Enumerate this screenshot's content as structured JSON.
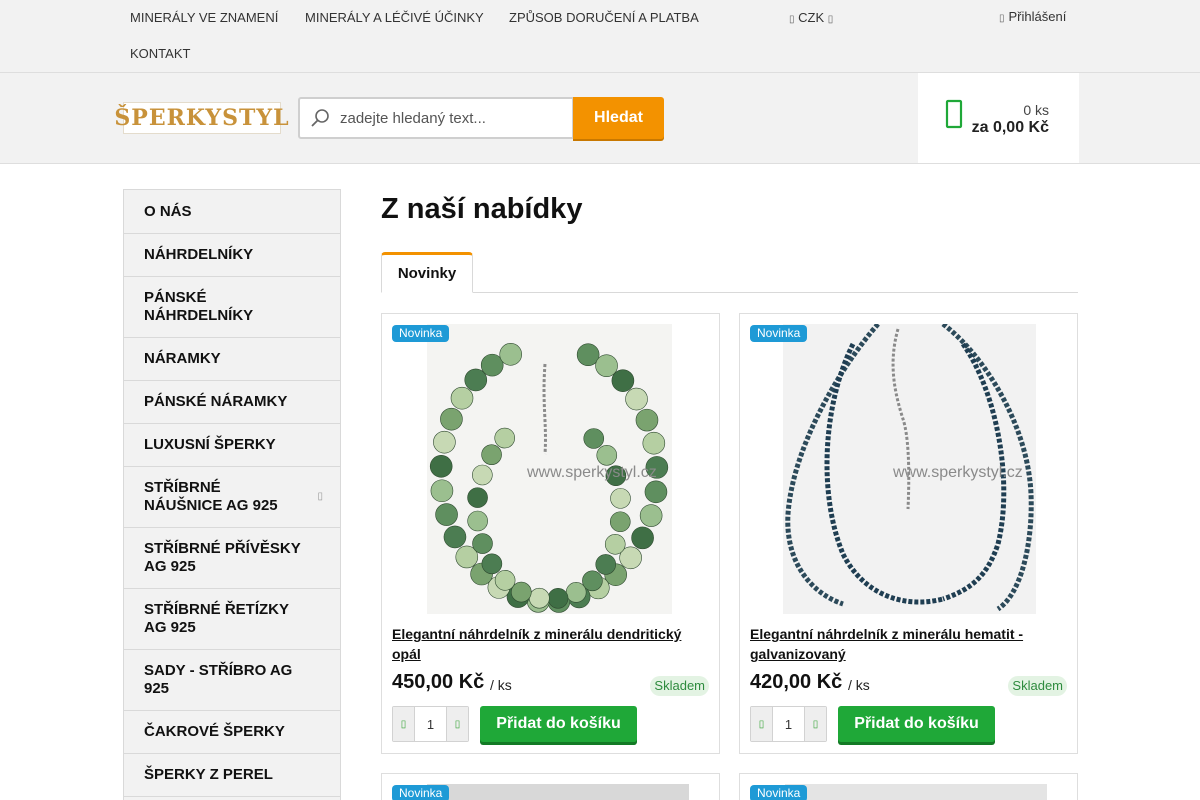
{
  "topnav": {
    "items": [
      "MINERÁLY VE ZNAMENÍ",
      "MINERÁLY A LÉČIVÉ ÚČINKY",
      "ZPŮSOB DORUČENÍ A PLATBA",
      "KONTAKT"
    ],
    "currency": "CZK",
    "login": "Přihlášení"
  },
  "header": {
    "logo": "ŠPERKYSTYL",
    "search_placeholder": "zadejte hledaný text...",
    "search_button": "Hledat",
    "cart_qty": "0 ks",
    "cart_total": "za 0,00 Kč"
  },
  "sidebar": {
    "items": [
      "O NÁS",
      "NÁHRDELNÍKY",
      "PÁNSKÉ NÁHRDELNÍKY",
      "NÁRAMKY",
      "PÁNSKÉ NÁRAMKY",
      "LUXUSNÍ ŠPERKY",
      "STŘÍBRNÉ NÁUŠNICE AG 925",
      "STŘÍBRNÉ PŘÍVĚSKY AG 925",
      "STŘÍBRNÉ ŘETÍZKY AG 925",
      "SADY - STŘÍBRO AG 925",
      "ČAKROVÉ ŠPERKY",
      "ŠPERKY Z PEREL"
    ]
  },
  "main": {
    "title": "Z naší nabídky",
    "tab": "Novinky",
    "watermark": "www.sperkystyl.cz",
    "products": [
      {
        "badge": "Novinka",
        "name": "Elegantní náhrdelník z minerálu dendritický opál",
        "price": "450,00 Kč",
        "unit": "/ ks",
        "stock": "Skladem",
        "qty": "1",
        "button": "Přidat do košíku"
      },
      {
        "badge": "Novinka",
        "name": "Elegantní náhrdelník z minerálu hematit - galvanizovaný",
        "price": "420,00 Kč",
        "unit": "/ ks",
        "stock": "Skladem",
        "qty": "1",
        "button": "Přidat do košíku"
      }
    ],
    "partial_badges": [
      "Novinka",
      "Novinka"
    ]
  },
  "colors": {
    "accent_orange": "#f39200",
    "accent_green": "#1fa838",
    "badge_blue": "#1e9ad6"
  }
}
